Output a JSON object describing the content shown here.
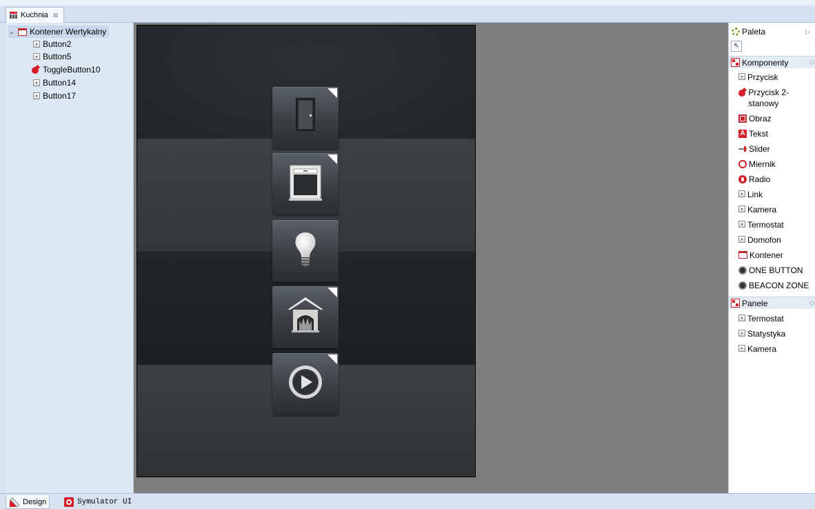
{
  "editor_tab": {
    "title": "Kuchnia",
    "close": "⊠"
  },
  "tree": {
    "root": {
      "label": "Kontener Wertykalny",
      "expand": "⌄"
    },
    "children": [
      {
        "label": "Button2",
        "icon": "button-icon"
      },
      {
        "label": "Button5",
        "icon": "button-icon"
      },
      {
        "label": "ToggleButton10",
        "icon": "toggle-icon"
      },
      {
        "label": "Button14",
        "icon": "button-icon"
      },
      {
        "label": "Button17",
        "icon": "button-icon"
      }
    ]
  },
  "canvas": {
    "tiles": [
      {
        "icon": "door-icon"
      },
      {
        "icon": "window-blind-icon"
      },
      {
        "icon": "light-bulb-icon"
      },
      {
        "icon": "fireplace-icon"
      },
      {
        "icon": "play-icon"
      }
    ]
  },
  "palette": {
    "title": "Paleta",
    "collapse": "▷",
    "tool": "⇖",
    "sections": [
      {
        "title": "Komponenty",
        "items": [
          {
            "label": "Przycisk",
            "icon": "button-icon"
          },
          {
            "label": "Przycisk 2-stanowy",
            "icon": "toggle-icon"
          },
          {
            "label": "Obraz",
            "icon": "image-icon"
          },
          {
            "label": "Tekst",
            "icon": "text-icon"
          },
          {
            "label": "Slider",
            "icon": "slider-icon"
          },
          {
            "label": "Miernik",
            "icon": "gauge-icon"
          },
          {
            "label": "Radio",
            "icon": "radio-icon"
          },
          {
            "label": "Link",
            "icon": "button-icon"
          },
          {
            "label": "Kamera",
            "icon": "button-icon"
          },
          {
            "label": "Termostat",
            "icon": "button-icon"
          },
          {
            "label": "Domofon",
            "icon": "button-icon"
          },
          {
            "label": "Kontener",
            "icon": "container-icon"
          },
          {
            "label": "ONE BUTTON",
            "icon": "dot-icon"
          },
          {
            "label": "BEACON ZONE",
            "icon": "dot-icon"
          }
        ]
      },
      {
        "title": "Panele",
        "items": [
          {
            "label": "Termostat",
            "icon": "button-icon"
          },
          {
            "label": "Statystyka",
            "icon": "button-icon"
          },
          {
            "label": "Kamera",
            "icon": "button-icon"
          }
        ]
      }
    ]
  },
  "bottom_tabs": [
    {
      "label": "Design",
      "active": true
    },
    {
      "label": "Symulator UI",
      "active": false
    }
  ]
}
